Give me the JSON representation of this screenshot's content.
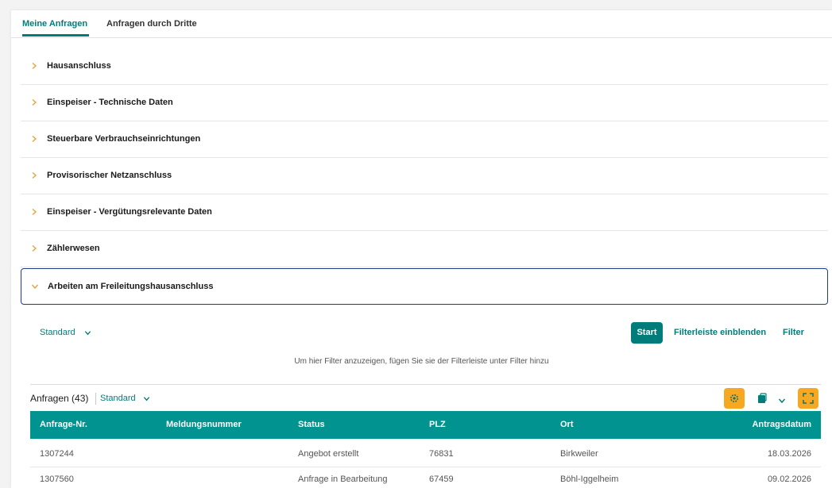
{
  "tabs": [
    {
      "label": "Meine Anfragen",
      "active": true
    },
    {
      "label": "Anfragen durch Dritte",
      "active": false
    }
  ],
  "accordion": [
    {
      "label": "Hausanschluss",
      "expanded": false
    },
    {
      "label": "Einspeiser - Technische Daten",
      "expanded": false
    },
    {
      "label": "Steuerbare Verbrauchseinrichtungen",
      "expanded": false
    },
    {
      "label": "Provisorischer Netzanschluss",
      "expanded": false
    },
    {
      "label": "Einspeiser - Vergütungsrelevante Daten",
      "expanded": false
    },
    {
      "label": "Zählerwesen",
      "expanded": false
    },
    {
      "label": "Arbeiten am Freileitungshausanschluss",
      "expanded": true
    }
  ],
  "filterbar": {
    "variant": "Standard",
    "start_label": "Start",
    "show_filterbar_label": "Filterleiste einblenden",
    "filter_label": "Filter",
    "hint": "Um hier Filter anzuzeigen, fügen Sie sie der Filterleiste unter Filter hinzu"
  },
  "table": {
    "title": "Anfragen (43)",
    "variant": "Standard",
    "columns": [
      "Anfrage-Nr.",
      "Meldungsnummer",
      "Status",
      "PLZ",
      "Ort",
      "Antragsdatum"
    ],
    "rows": [
      [
        "1307244",
        "",
        "Angebot erstellt",
        "76831",
        "Birkweiler",
        "18.03.2026"
      ],
      [
        "1307560",
        "",
        "Anfrage in Bearbeitung",
        "67459",
        "Böhl-Iggelheim",
        "09.02.2026"
      ]
    ]
  },
  "colors": {
    "accent": "#007d7b",
    "table_header": "#00938f",
    "tool_button": "#f7a823",
    "chevron": "#e8a33d",
    "focus_border": "#1f3c88"
  },
  "icons": {
    "accordion_collapsed": "chevron-right-icon",
    "accordion_expanded": "chevron-down-icon",
    "settings": "gear-icon",
    "export": "export-icon",
    "fullscreen": "fullscreen-icon"
  }
}
